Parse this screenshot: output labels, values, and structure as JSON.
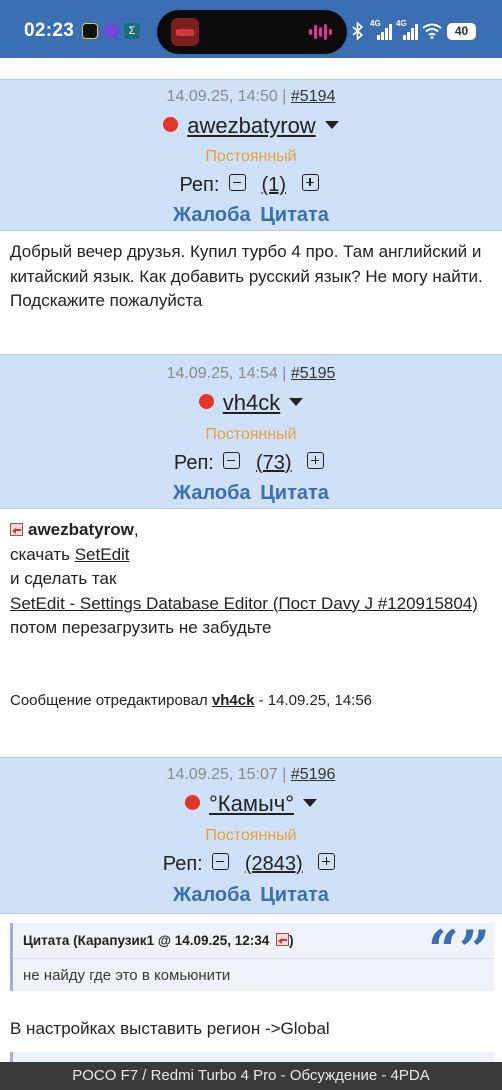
{
  "status_bar": {
    "time": "02:23",
    "battery": "40",
    "signal_label_1": "4G",
    "signal_label_2": "4G"
  },
  "posts": [
    {
      "date": "14.09.25, 14:50",
      "separator": "|",
      "number": "#5194",
      "username": "awezbatyrow",
      "status": "Постоянный",
      "rep_label": "Реп:",
      "rep_value": "(1)",
      "complaint": "Жалоба",
      "quote": "Цитата",
      "text": "Добрый вечер друзья. Купил турбо 4 про. Там английский и китайский язык. Как добавить русский язык? Не могу найти. Подскажите пожалуйста"
    },
    {
      "date": "14.09.25, 14:54",
      "separator": "|",
      "number": "#5195",
      "username": "vh4ck",
      "status": "Постоянный",
      "rep_label": "Реп:",
      "rep_value": "(73)",
      "complaint": "Жалоба",
      "quote": "Цитата",
      "reply_to": "awezbatyrow",
      "reply_comma": ",",
      "line_download": "скачать",
      "link_setedit": "SetEdit",
      "line_do": "и сделать так",
      "link_post": "SetEdit - Settings Database Editor (Пост Davy J #120915804)",
      "line_reboot": "потом перезагрузить не забудьте",
      "edited_prefix": "Сообщение отредактировал",
      "edited_user": "vh4ck",
      "edited_suffix": "- 14.09.25, 14:56"
    },
    {
      "date": "14.09.25, 15:07",
      "separator": "|",
      "number": "#5196",
      "username": "°Камыч°",
      "status": "Постоянный",
      "rep_label": "Реп:",
      "rep_value": "(2843)",
      "complaint": "Жалоба",
      "quote": "Цитата",
      "quote_header": "Цитата (Карапузик1 @ 14.09.25, 12:34",
      "quote_header_end": ")",
      "quote_text": "не найду где это в комьюнити",
      "text": "В настройках выставить регион ->Global"
    }
  ],
  "bottom_bar": {
    "title": "POCO F7 / Redmi Turbo 4 Pro - Обсуждение - 4PDA"
  },
  "colors": {
    "status_bar_bg": "#3b6fb3",
    "header_bg": "#cfe1f6",
    "accent_blue": "#3a6fb0",
    "status_orange": "#e8a13a",
    "online_dot": "#e53528"
  }
}
